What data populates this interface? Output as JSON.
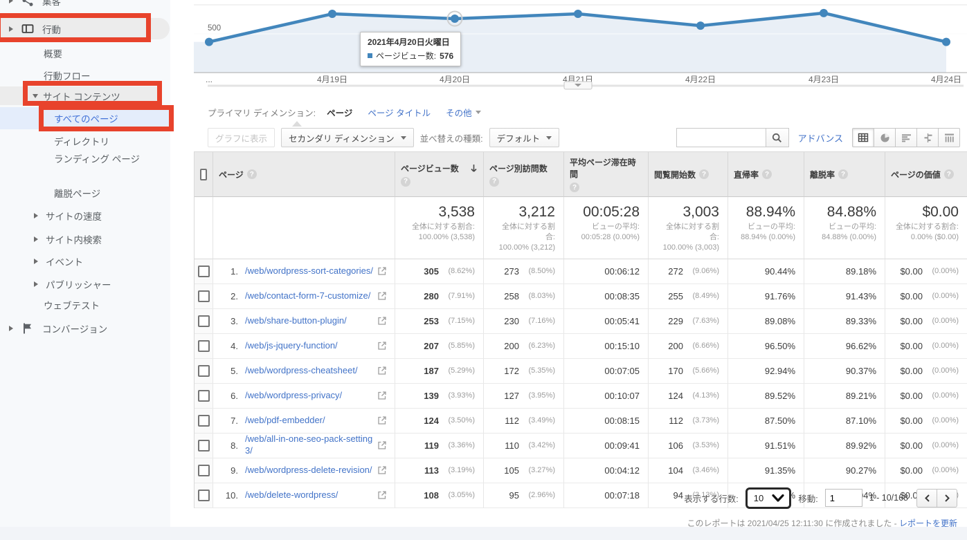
{
  "colors": {
    "accent_blue": "#4286bc",
    "link_blue": "#4272c8",
    "annotation_red": "#e8432c",
    "selected_row_bg": "#e4edfb"
  },
  "icons": {
    "help": "?"
  },
  "sidebar": {
    "items": [
      {
        "label": "集客",
        "level": 1,
        "expand": "right",
        "icon": "share"
      },
      {
        "label": "行動",
        "level": 1,
        "expand": "right",
        "icon": "behavior",
        "style": "pill",
        "annotated": true
      },
      {
        "label": "概要",
        "level": 2
      },
      {
        "label": "行動フロー",
        "level": 2
      },
      {
        "label": "サイト コンテンツ",
        "level": 2,
        "expand": "down",
        "style": "graybg",
        "annotated": true
      },
      {
        "label": "すべてのページ",
        "level": 3,
        "style": "selbg",
        "selected": true,
        "annotated": true
      },
      {
        "label": "ディレクトリ",
        "level": 3
      },
      {
        "label": "ランディング ページ",
        "level": 3,
        "wrap": true
      },
      {
        "label": "離脱ページ",
        "level": 3
      },
      {
        "label": "サイトの速度",
        "level": 2,
        "expand": "right"
      },
      {
        "label": "サイト内検索",
        "level": 2,
        "expand": "right"
      },
      {
        "label": "イベント",
        "level": 2,
        "expand": "right"
      },
      {
        "label": "パブリッシャー",
        "level": 2,
        "expand": "right"
      },
      {
        "label": "ウェブテスト",
        "level": 2
      },
      {
        "label": "コンバージョン",
        "level": 1,
        "expand": "right",
        "icon": "flag"
      }
    ]
  },
  "chart_data": {
    "type": "line",
    "series_name": "ページビュー数",
    "x_labels": [
      "...",
      "4月19日",
      "4月20日",
      "4月21日",
      "4月22日",
      "4月23日",
      "4月24日"
    ],
    "values": [
      460,
      600,
      576,
      600,
      541,
      604,
      460
    ],
    "hover_index": 2,
    "y_tick": "500",
    "ylim": [
      350,
      700
    ],
    "grid": "on",
    "tooltip": {
      "date": "2021年4月20日火曜日",
      "label": "ページビュー数:",
      "value": "576"
    }
  },
  "dimension_bar": {
    "label": "プライマリ ディメンション:",
    "tabs": [
      {
        "label": "ページ"
      },
      {
        "label": "ページ タイトル"
      },
      {
        "label": "その他"
      }
    ]
  },
  "controls": {
    "graph_button": "グラフに表示",
    "secondary_dimension": "セカンダリ ディメンション",
    "sort_label": "並べ替えの種類:",
    "sort_value": "デフォルト",
    "search_value": "",
    "advanced": "アドバンス",
    "view_modes": [
      "table-view",
      "percentage-view",
      "performance-view",
      "comparison-view",
      "pivot-view"
    ]
  },
  "table": {
    "headers": [
      "ページ",
      "ページビュー数",
      "ページ別訪問数",
      "平均ページ滞在時間",
      "閲覧開始数",
      "直帰率",
      "離脱率",
      "ページの価値"
    ],
    "sorted_column": "ページビュー数",
    "summary": [
      {
        "main": "3,538",
        "sub1": "全体に対する割合:",
        "sub2": "100.00% (3,538)"
      },
      {
        "main": "3,212",
        "sub1": "全体に対する割合:",
        "sub2": "100.00% (3,212)"
      },
      {
        "main": "00:05:28",
        "sub1": "ビューの平均:",
        "sub2": "00:05:28 (0.00%)"
      },
      {
        "main": "3,003",
        "sub1": "全体に対する割合:",
        "sub2": "100.00% (3,003)"
      },
      {
        "main": "88.94%",
        "sub1": "ビューの平均:",
        "sub2": "88.94% (0.00%)"
      },
      {
        "main": "84.88%",
        "sub1": "ビューの平均:",
        "sub2": "84.88% (0.00%)"
      },
      {
        "main": "$0.00",
        "sub1": "全体に対する割合:",
        "sub2": "0.00% ($0.00)"
      }
    ],
    "rows": [
      {
        "n": "1.",
        "url": "/web/wordpress-sort-categories/",
        "pv": "305",
        "pvp": "(8.62%)",
        "uv": "273",
        "uvp": "(8.50%)",
        "time": "00:06:12",
        "en": "272",
        "enp": "(9.06%)",
        "br": "90.44%",
        "er": "89.18%",
        "val": "$0.00",
        "valp": "(0.00%)"
      },
      {
        "n": "2.",
        "url": "/web/contact-form-7-customize/",
        "pv": "280",
        "pvp": "(7.91%)",
        "uv": "258",
        "uvp": "(8.03%)",
        "time": "00:08:35",
        "en": "255",
        "enp": "(8.49%)",
        "br": "91.76%",
        "er": "91.43%",
        "val": "$0.00",
        "valp": "(0.00%)"
      },
      {
        "n": "3.",
        "url": "/web/share-button-plugin/",
        "pv": "253",
        "pvp": "(7.15%)",
        "uv": "230",
        "uvp": "(7.16%)",
        "time": "00:05:41",
        "en": "229",
        "enp": "(7.63%)",
        "br": "89.08%",
        "er": "89.33%",
        "val": "$0.00",
        "valp": "(0.00%)"
      },
      {
        "n": "4.",
        "url": "/web/js-jquery-function/",
        "pv": "207",
        "pvp": "(5.85%)",
        "uv": "200",
        "uvp": "(6.23%)",
        "time": "00:15:10",
        "en": "200",
        "enp": "(6.66%)",
        "br": "96.50%",
        "er": "96.62%",
        "val": "$0.00",
        "valp": "(0.00%)"
      },
      {
        "n": "5.",
        "url": "/web/wordpress-cheatsheet/",
        "pv": "187",
        "pvp": "(5.29%)",
        "uv": "172",
        "uvp": "(5.35%)",
        "time": "00:07:05",
        "en": "170",
        "enp": "(5.66%)",
        "br": "92.94%",
        "er": "90.37%",
        "val": "$0.00",
        "valp": "(0.00%)"
      },
      {
        "n": "6.",
        "url": "/web/wordpress-privacy/",
        "pv": "139",
        "pvp": "(3.93%)",
        "uv": "127",
        "uvp": "(3.95%)",
        "time": "00:10:07",
        "en": "124",
        "enp": "(4.13%)",
        "br": "89.52%",
        "er": "89.21%",
        "val": "$0.00",
        "valp": "(0.00%)"
      },
      {
        "n": "7.",
        "url": "/web/pdf-embedder/",
        "pv": "124",
        "pvp": "(3.50%)",
        "uv": "112",
        "uvp": "(3.49%)",
        "time": "00:08:15",
        "en": "112",
        "enp": "(3.73%)",
        "br": "87.50%",
        "er": "87.10%",
        "val": "$0.00",
        "valp": "(0.00%)"
      },
      {
        "n": "8.",
        "url": "/web/all-in-one-seo-pack-setting3/",
        "pv": "119",
        "pvp": "(3.36%)",
        "uv": "110",
        "uvp": "(3.42%)",
        "time": "00:09:41",
        "en": "106",
        "enp": "(3.53%)",
        "br": "91.51%",
        "er": "89.92%",
        "val": "$0.00",
        "valp": "(0.00%)"
      },
      {
        "n": "9.",
        "url": "/web/wordpress-delete-revision/",
        "pv": "113",
        "pvp": "(3.19%)",
        "uv": "105",
        "uvp": "(3.27%)",
        "time": "00:04:12",
        "en": "104",
        "enp": "(3.46%)",
        "br": "91.35%",
        "er": "90.27%",
        "val": "$0.00",
        "valp": "(0.00%)"
      },
      {
        "n": "10.",
        "url": "/web/delete-wordpress/",
        "pv": "108",
        "pvp": "(3.05%)",
        "uv": "95",
        "uvp": "(2.96%)",
        "time": "00:07:18",
        "en": "94",
        "enp": "(3.13%)",
        "br": "88.30%",
        "er": "87.04%",
        "val": "$0.00",
        "valp": "(0.00%)"
      }
    ]
  },
  "footer": {
    "rows_label": "表示する行数:",
    "rows_value": "10",
    "goto_label": "移動:",
    "goto_value": "1",
    "range": "1 - 10/168"
  },
  "report_note": {
    "text": "このレポートは 2021/04/25 12:11:30 に作成されました - ",
    "link": "レポートを更新"
  }
}
